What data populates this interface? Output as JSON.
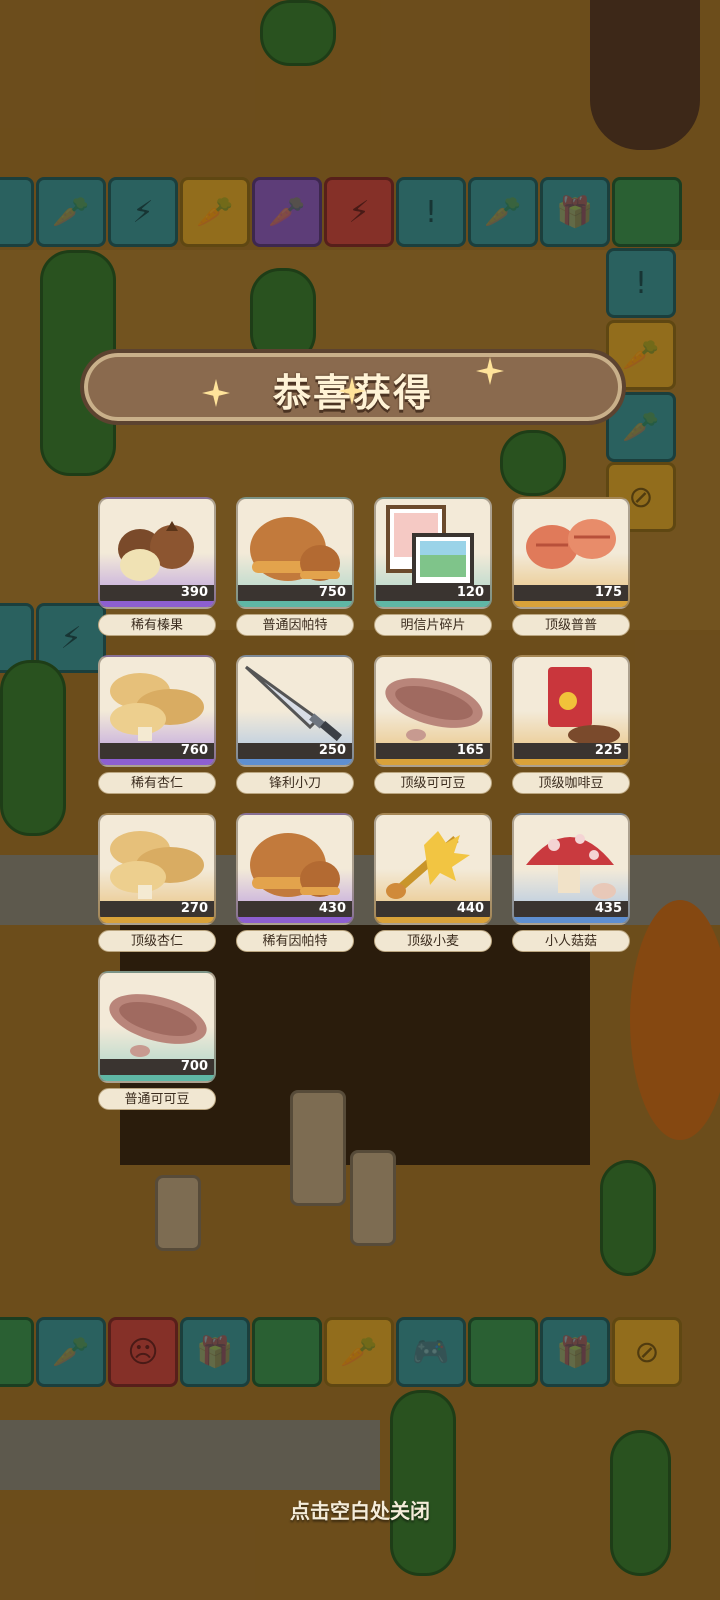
{
  "dialog": {
    "title": "恭喜获得",
    "close_hint": "点击空白处关闭"
  },
  "items": [
    {
      "name": "稀有榛果",
      "qty": "390",
      "rarity": "rare",
      "icon": "hazelnut-icon"
    },
    {
      "name": "普通因帕特",
      "qty": "750",
      "rarity": "common",
      "icon": "impat-nut-icon"
    },
    {
      "name": "明信片碎片",
      "qty": "120",
      "rarity": "plain",
      "icon": "postcard-icon"
    },
    {
      "name": "顶级普普",
      "qty": "175",
      "rarity": "top",
      "icon": "pupu-icon"
    },
    {
      "name": "稀有杏仁",
      "qty": "760",
      "rarity": "rare",
      "icon": "almond-icon"
    },
    {
      "name": "锋利小刀",
      "qty": "250",
      "rarity": "blue",
      "icon": "knife-icon"
    },
    {
      "name": "顶级可可豆",
      "qty": "165",
      "rarity": "top",
      "icon": "cocoa-bean-icon"
    },
    {
      "name": "顶级咖啡豆",
      "qty": "225",
      "rarity": "top",
      "icon": "coffee-bean-bag-icon"
    },
    {
      "name": "顶级杏仁",
      "qty": "270",
      "rarity": "top",
      "icon": "almond-icon"
    },
    {
      "name": "稀有因帕特",
      "qty": "430",
      "rarity": "rare",
      "icon": "impat-nut-icon"
    },
    {
      "name": "顶级小麦",
      "qty": "440",
      "rarity": "top",
      "icon": "wheat-icon"
    },
    {
      "name": "小人菇菇",
      "qty": "435",
      "rarity": "blue",
      "icon": "mushroom-icon"
    },
    {
      "name": "普通可可豆",
      "qty": "700",
      "rarity": "common",
      "icon": "cocoa-bean-icon"
    }
  ],
  "colors": {
    "banner": "#8a6a4e",
    "common": "#5fb7a5",
    "rare": "#8d5fd0",
    "top": "#d9a23a",
    "blue": "#5f8fd0"
  }
}
